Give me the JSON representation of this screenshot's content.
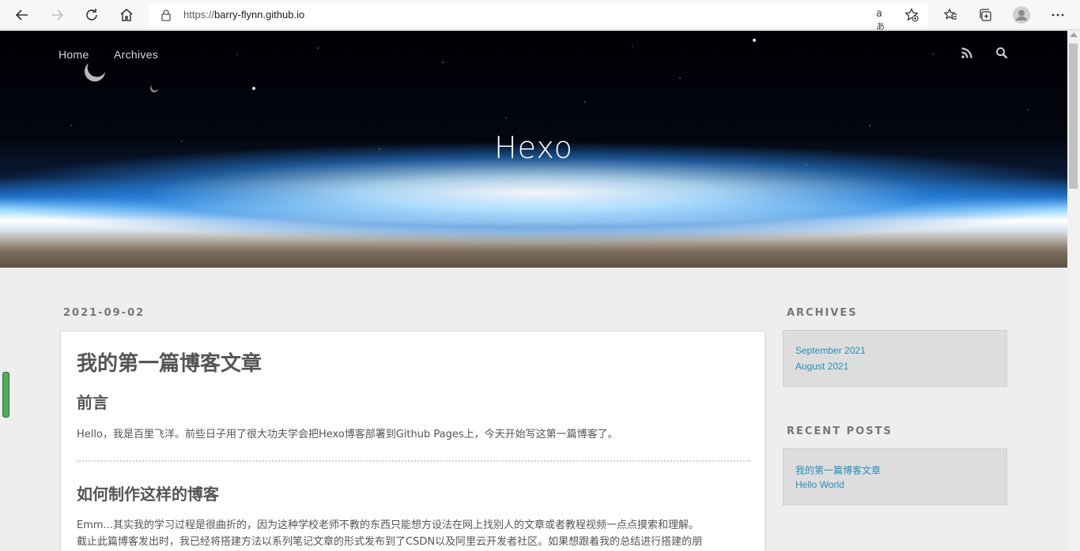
{
  "browser": {
    "url_prefix": "https://",
    "url_host": "barry-flynn.github.io",
    "icons": [
      "back-icon",
      "forward-icon",
      "refresh-icon",
      "home-icon",
      "lock-icon",
      "read-aloud-icon",
      "add-favorite-icon",
      "favorites-icon",
      "collections-icon",
      "profile-icon",
      "more-icon"
    ]
  },
  "nav": {
    "home": "Home",
    "archives": "Archives",
    "icons": [
      "rss-icon",
      "search-icon"
    ]
  },
  "banner": {
    "title": "Hexo"
  },
  "post": {
    "date": "2021-09-02",
    "title": "我的第一篇博客文章",
    "h_intro": "前言",
    "intro": "Hello，我是百里飞洋。前些日子用了很大功夫学会把Hexo博客部署到Github Pages上，今天开始写这第一篇博客了。",
    "h_how": "如何制作这样的博客",
    "how_line1": "Emm...其实我的学习过程是很曲折的，因为这种学校老师不教的东西只能想方设法在网上找别人的文章或者教程视频一点点摸索和理解。",
    "how_line2": "截止此篇博客发出时，我已经将搭建方法以系列笔记文章的形式发布到了CSDN以及阿里云开发者社区。如果想跟着我的总结进行搭建的朋"
  },
  "sidebar": {
    "archives_title": "ARCHIVES",
    "archives": [
      "September 2021",
      "August 2021"
    ],
    "recent_title": "RECENT POSTS",
    "recent": [
      "我的第一篇博客文章",
      "Hello World"
    ],
    "link_color": "#258fb8"
  }
}
